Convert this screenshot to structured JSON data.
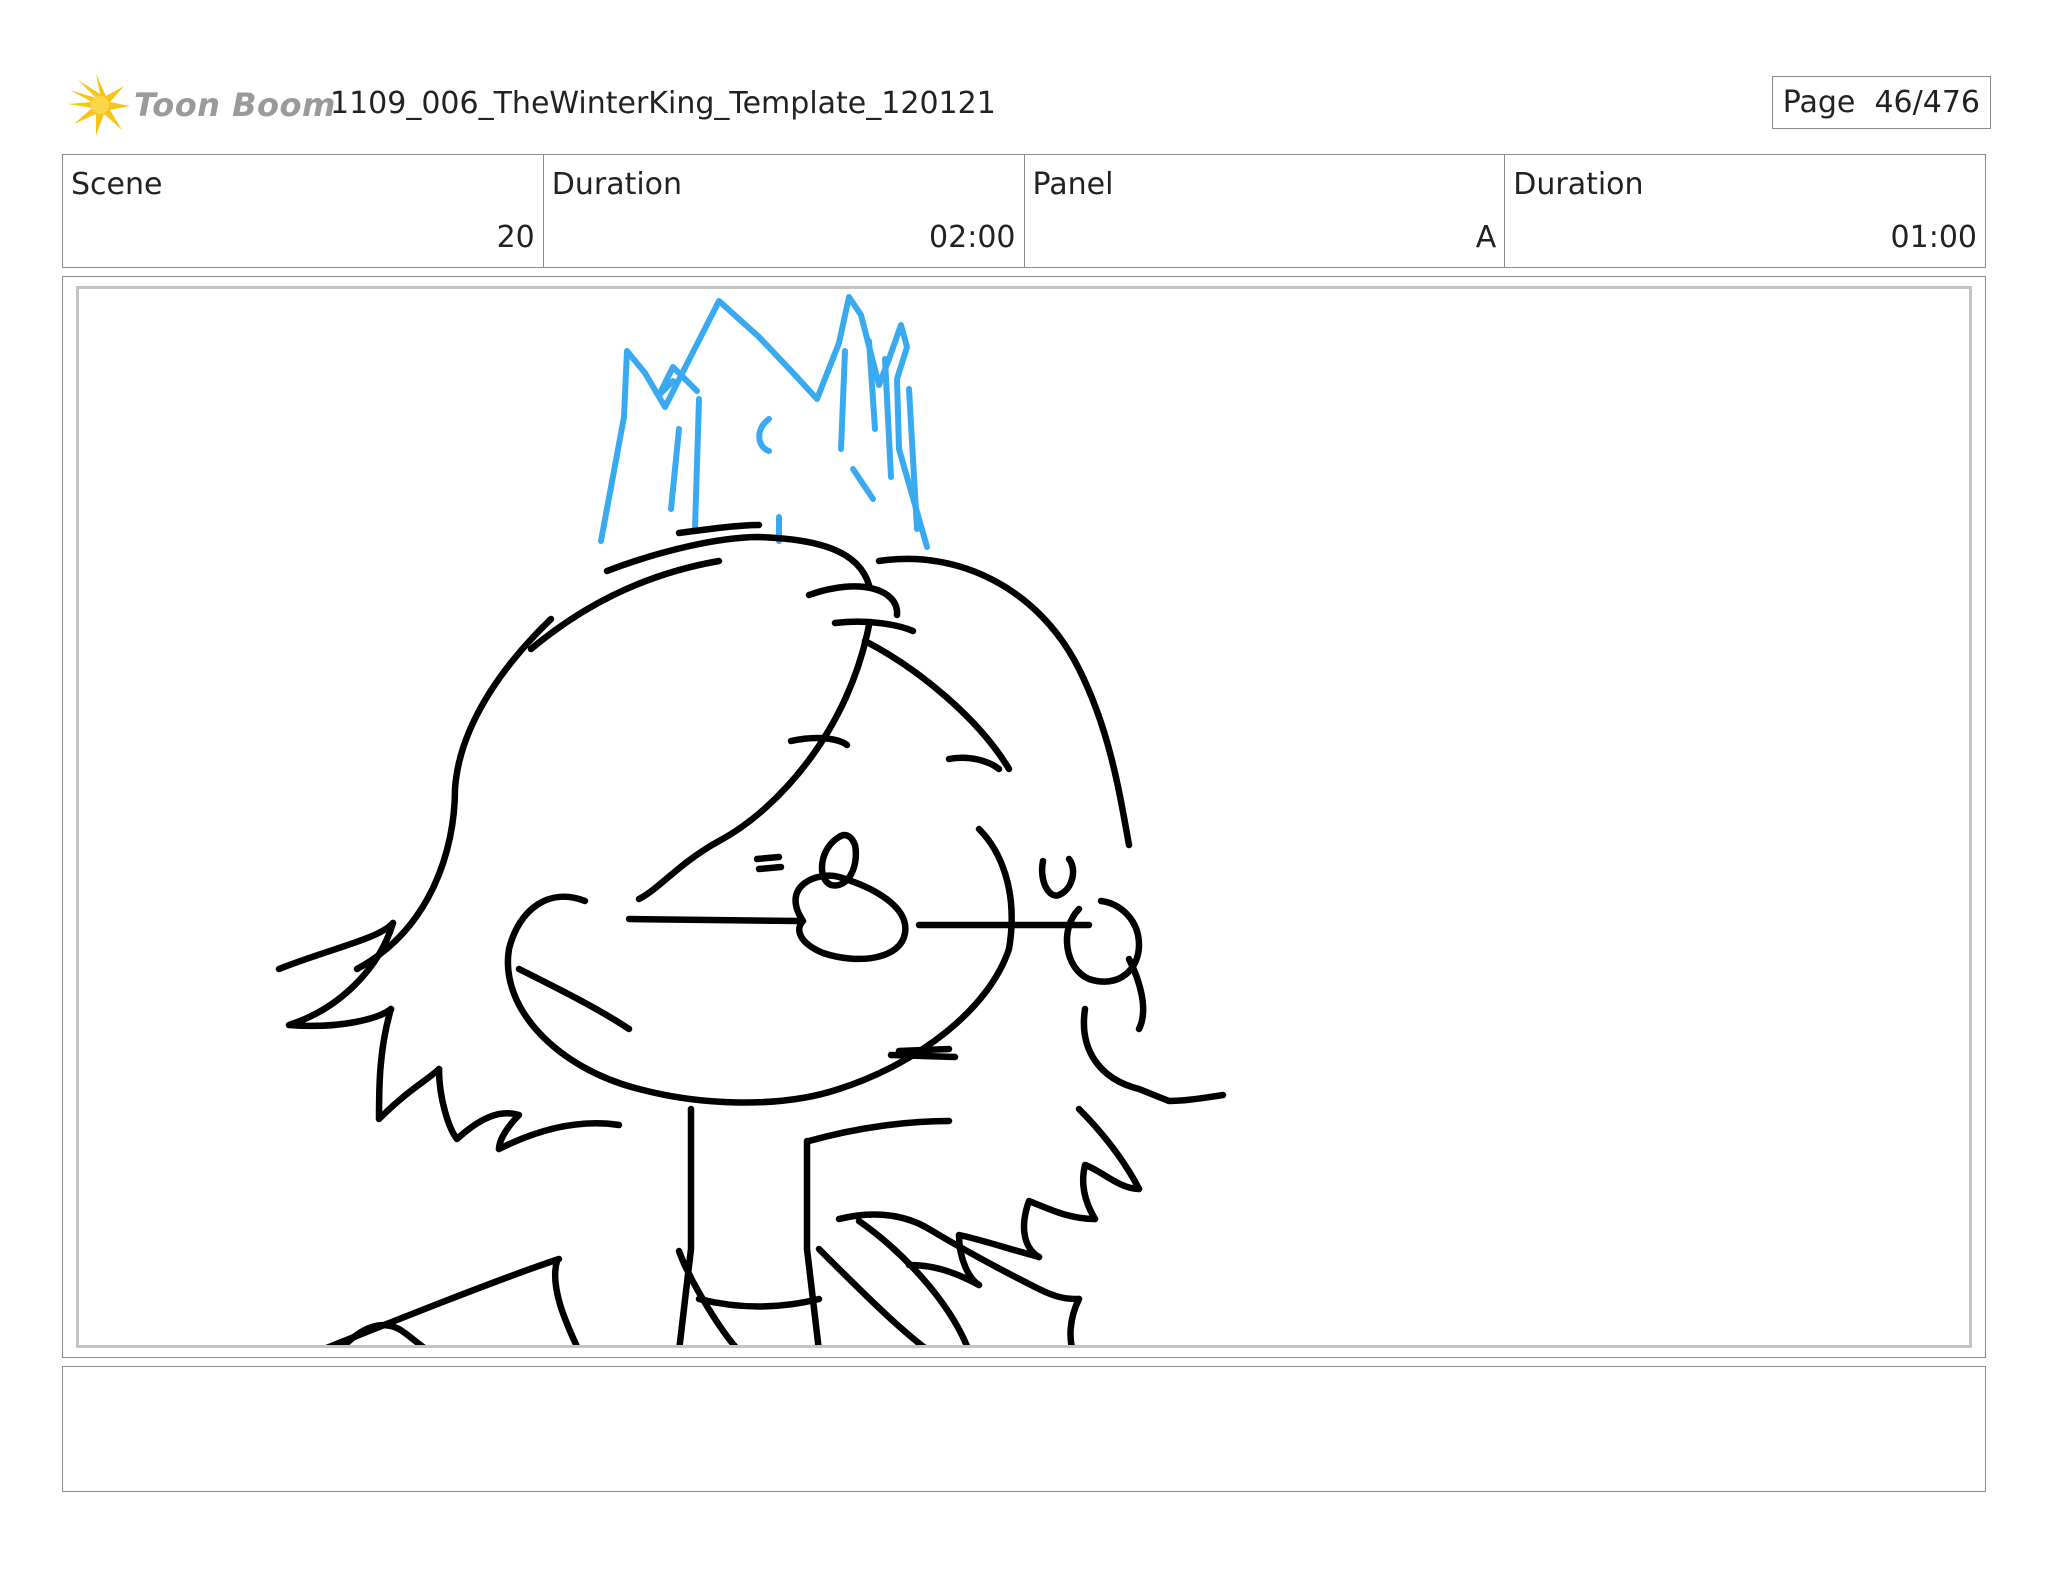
{
  "header": {
    "logo_text": "Toon Boom",
    "document_title": "1109_006_TheWinterKing_Template_120121",
    "page_label": "Page",
    "page_value": "46/476"
  },
  "info": {
    "scene_label": "Scene",
    "scene_value": "20",
    "scene_duration_label": "Duration",
    "scene_duration_value": "02:00",
    "panel_label": "Panel",
    "panel_value": "A",
    "panel_duration_label": "Duration",
    "panel_duration_value": "01:00"
  },
  "colors": {
    "sketch_line": "#000000",
    "crown_line": "#3aaaf0",
    "logo_star": "#f7c418",
    "logo_text": "#9a9a9a"
  },
  "notes": {
    "text": ""
  }
}
